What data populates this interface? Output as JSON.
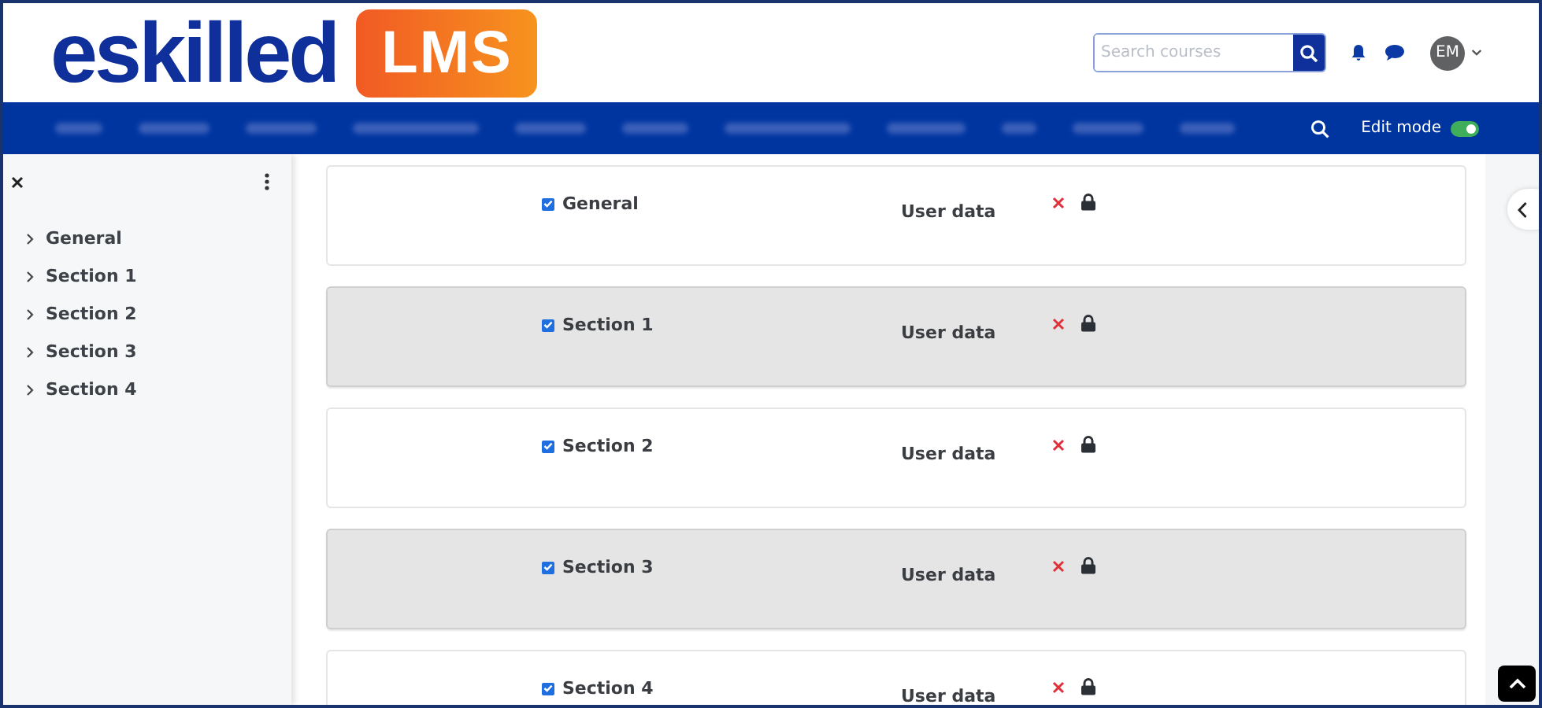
{
  "header": {
    "logo": {
      "text": "eskilled",
      "badge": "LMS"
    },
    "search": {
      "placeholder": "Search courses"
    },
    "avatar": {
      "initials": "EM"
    }
  },
  "navbar": {
    "edit_mode": {
      "label": "Edit mode",
      "on": true
    }
  },
  "sidebar": {
    "items": [
      {
        "label": "General",
        "expanded": false
      },
      {
        "label": "Section 1",
        "expanded": false
      },
      {
        "label": "Section 2",
        "expanded": false
      },
      {
        "label": "Section 3",
        "expanded": false
      },
      {
        "label": "Section 4",
        "expanded": false
      }
    ]
  },
  "sections": [
    {
      "title": "General",
      "checked": true,
      "shaded": false,
      "label": "User data"
    },
    {
      "title": "Section 1",
      "checked": true,
      "shaded": true,
      "label": "User data"
    },
    {
      "title": "Section 2",
      "checked": true,
      "shaded": false,
      "label": "User data"
    },
    {
      "title": "Section 3",
      "checked": true,
      "shaded": true,
      "label": "User data"
    },
    {
      "title": "Section 4",
      "checked": true,
      "shaded": false,
      "label": "User data"
    }
  ]
}
